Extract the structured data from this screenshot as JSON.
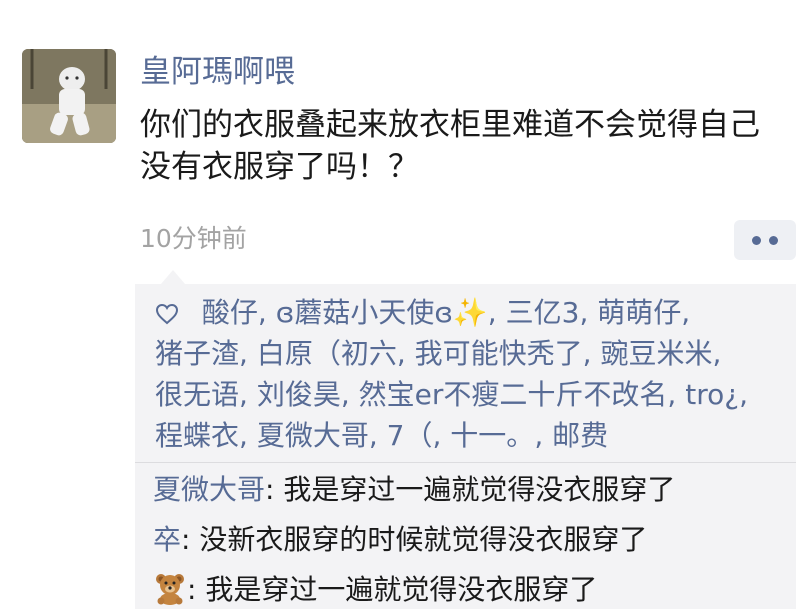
{
  "post": {
    "nickname": "皇阿瑪啊喂",
    "content": "你们的衣服叠起来放衣柜里难道不会觉得自己没有衣服穿了吗！？",
    "time": "10分钟前"
  },
  "likes": [
    "酸仔",
    "ɞ蘑菇小天使ɞ✨",
    "三亿3",
    "萌萌仔",
    "猪子渣",
    "白原（初六",
    "我可能快秃了",
    "豌豆米米",
    "很无语",
    "刘俊昊",
    "然宝er不瘦二十斤不改名",
    "tro¿",
    "程蝶衣",
    "夏微大哥",
    "7（",
    "十一。",
    "邮费"
  ],
  "comments": [
    {
      "author": "夏微大哥",
      "text": "我是穿过一遍就觉得没衣服穿了",
      "author_icon": ""
    },
    {
      "author": "卒",
      "text": "没新衣服穿的时候就觉得没衣服穿了",
      "author_icon": ""
    },
    {
      "author": "",
      "author_icon": "teddy-bear-emoji",
      "text": "我是穿过一遍就觉得没衣服穿了"
    }
  ],
  "separators": {
    "name_sep": ", ",
    "comment_sep": ": "
  },
  "colors": {
    "link": "#576b95",
    "panel_bg": "#f3f3f5",
    "time": "#a3a3a3"
  }
}
